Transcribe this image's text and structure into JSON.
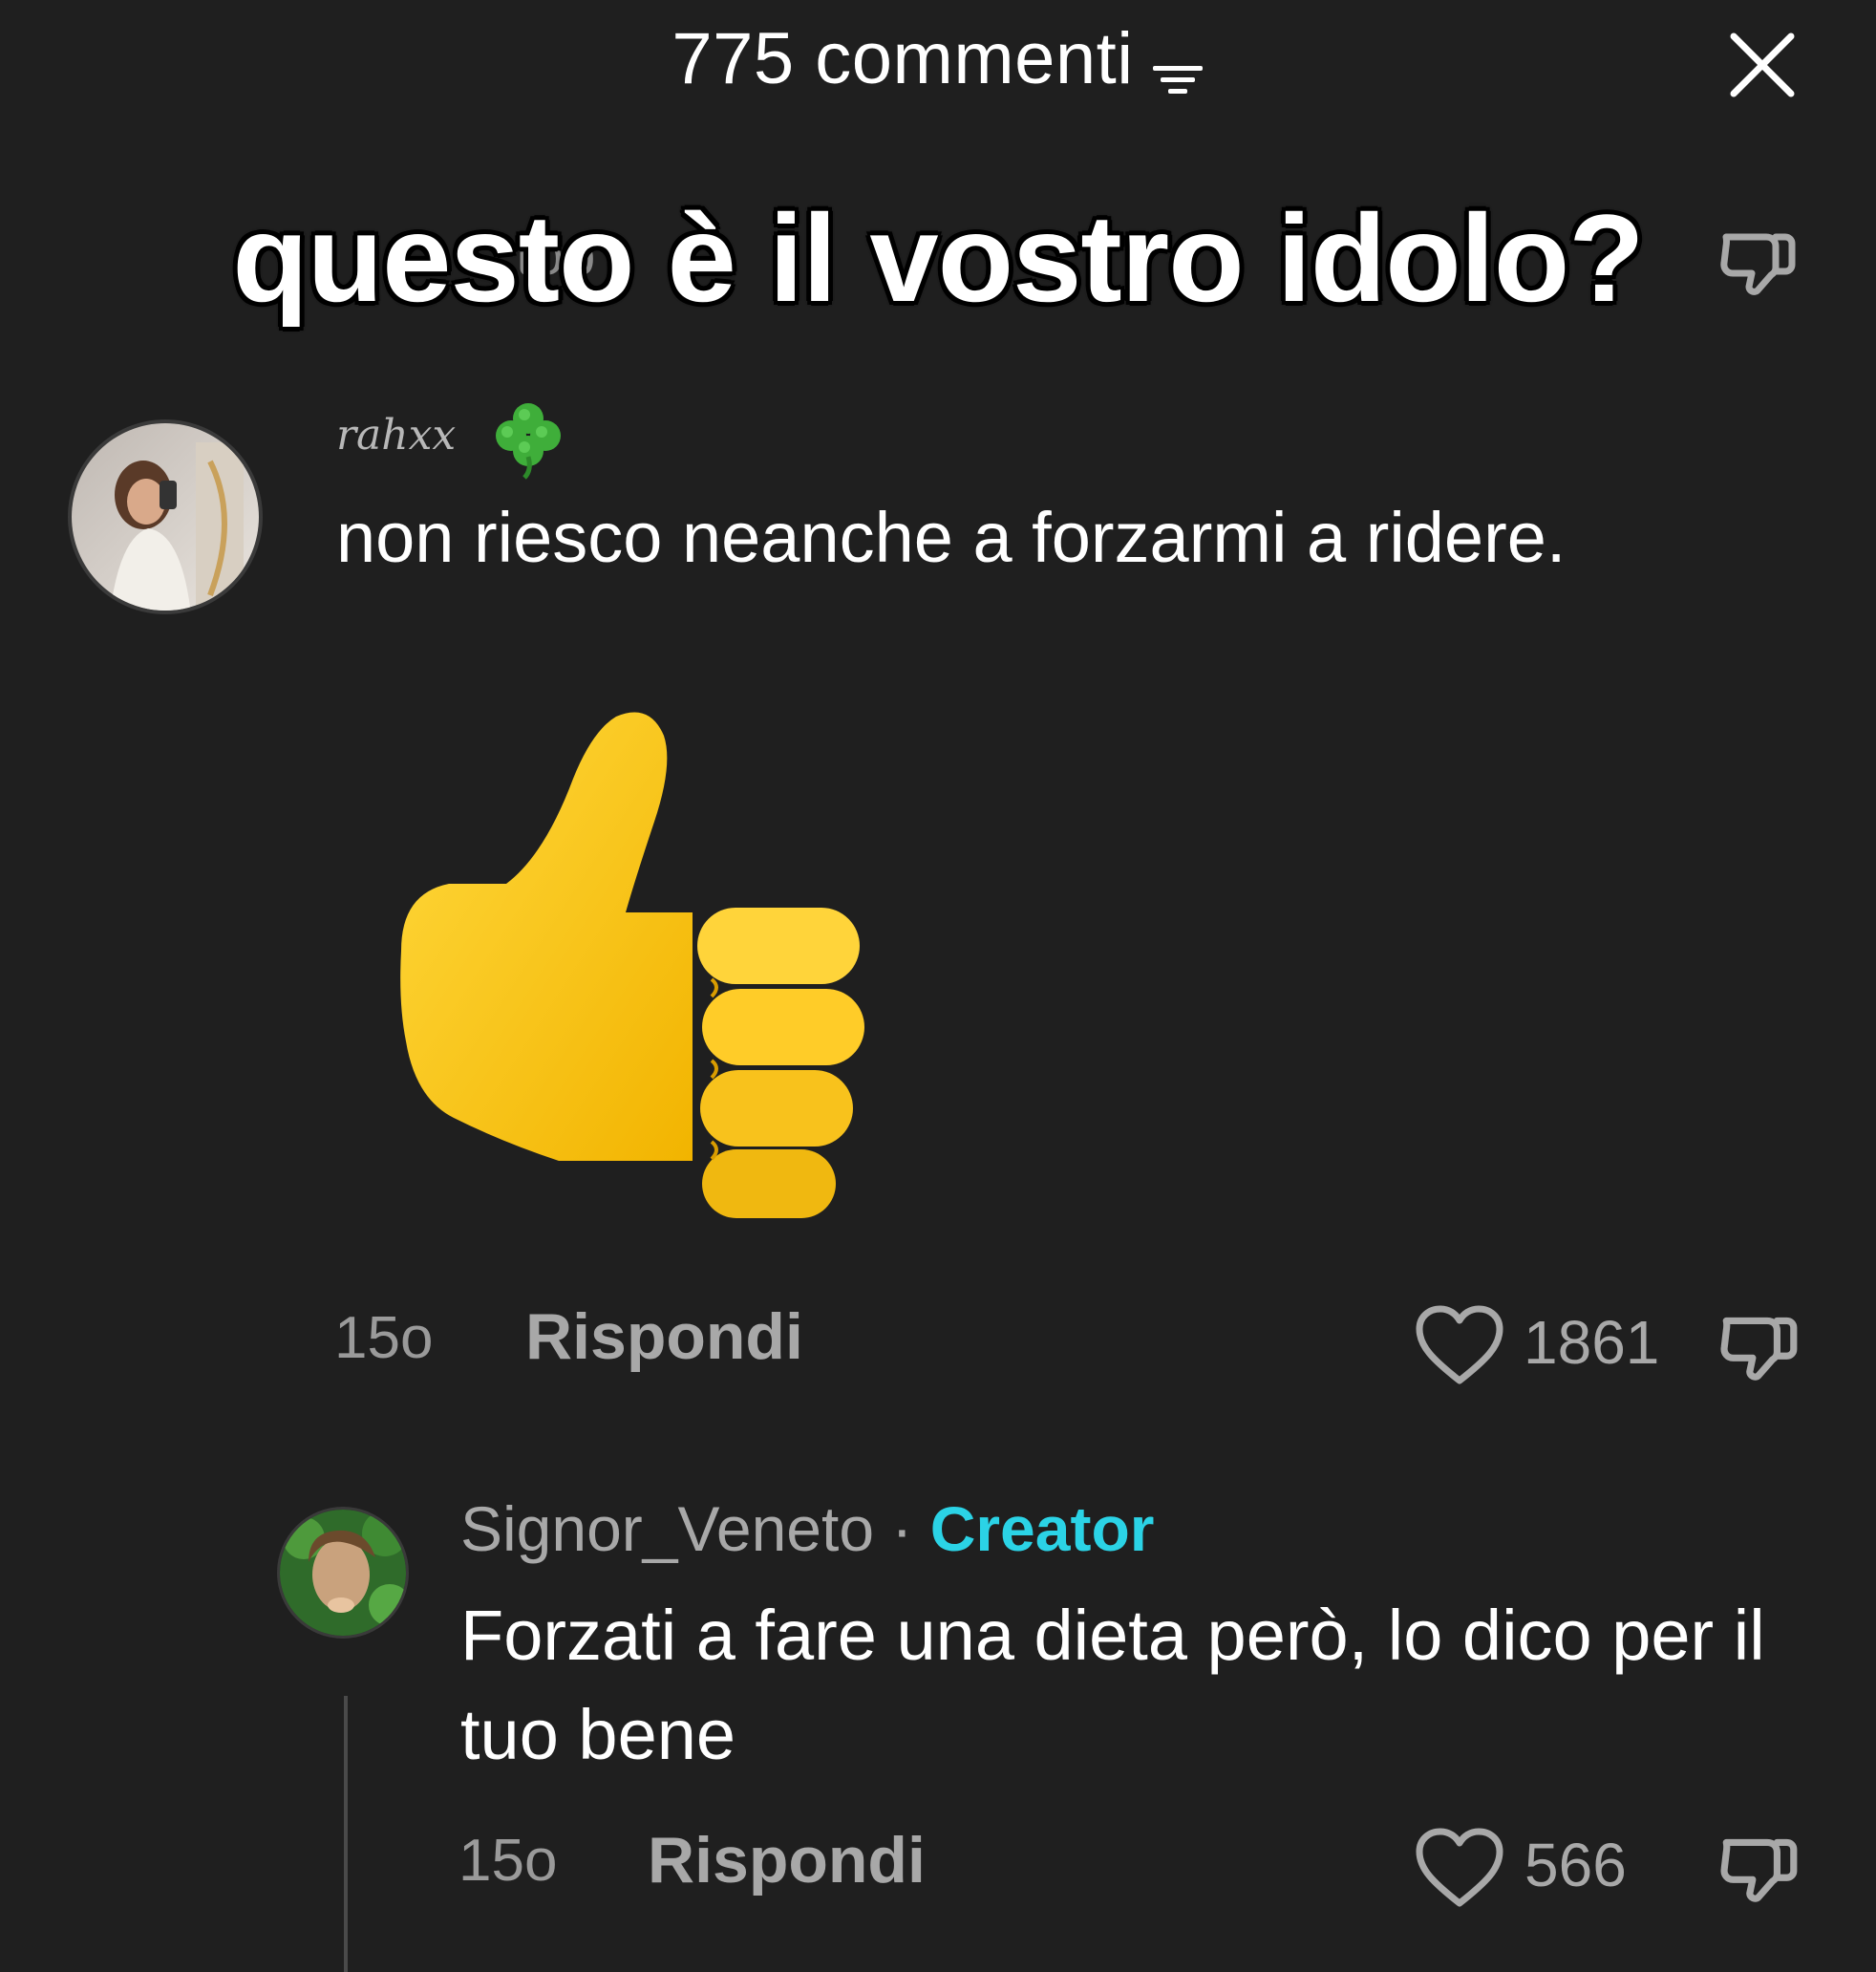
{
  "header": {
    "title": "775 commenti",
    "filter_icon": "filter-icon",
    "close_icon": "close-icon"
  },
  "overlay": {
    "caption": "questo è il vostro idolo?",
    "partial_hidden_text": "top"
  },
  "comments": [
    {
      "username": "rahxx",
      "username_emoji": "clover-icon",
      "text": "non riesco neanche a forzarmi a ridere.",
      "attachment": "thumbs-up-emoji",
      "time": "15o",
      "reply_label": "Rispondi",
      "likes": "1861"
    },
    {
      "username": "Signor_Veneto",
      "separator": "·",
      "badge": "Creator",
      "text": "Forzati a fare una dieta però, lo dico per il tuo bene",
      "time": "15o",
      "reply_label": "Rispondi",
      "likes": "566"
    }
  ],
  "colors": {
    "background": "#1f1f1f",
    "creator_accent": "#2bd3e6",
    "muted_text": "#a8a8a8",
    "emoji_yellow": "#ffcd2a"
  }
}
